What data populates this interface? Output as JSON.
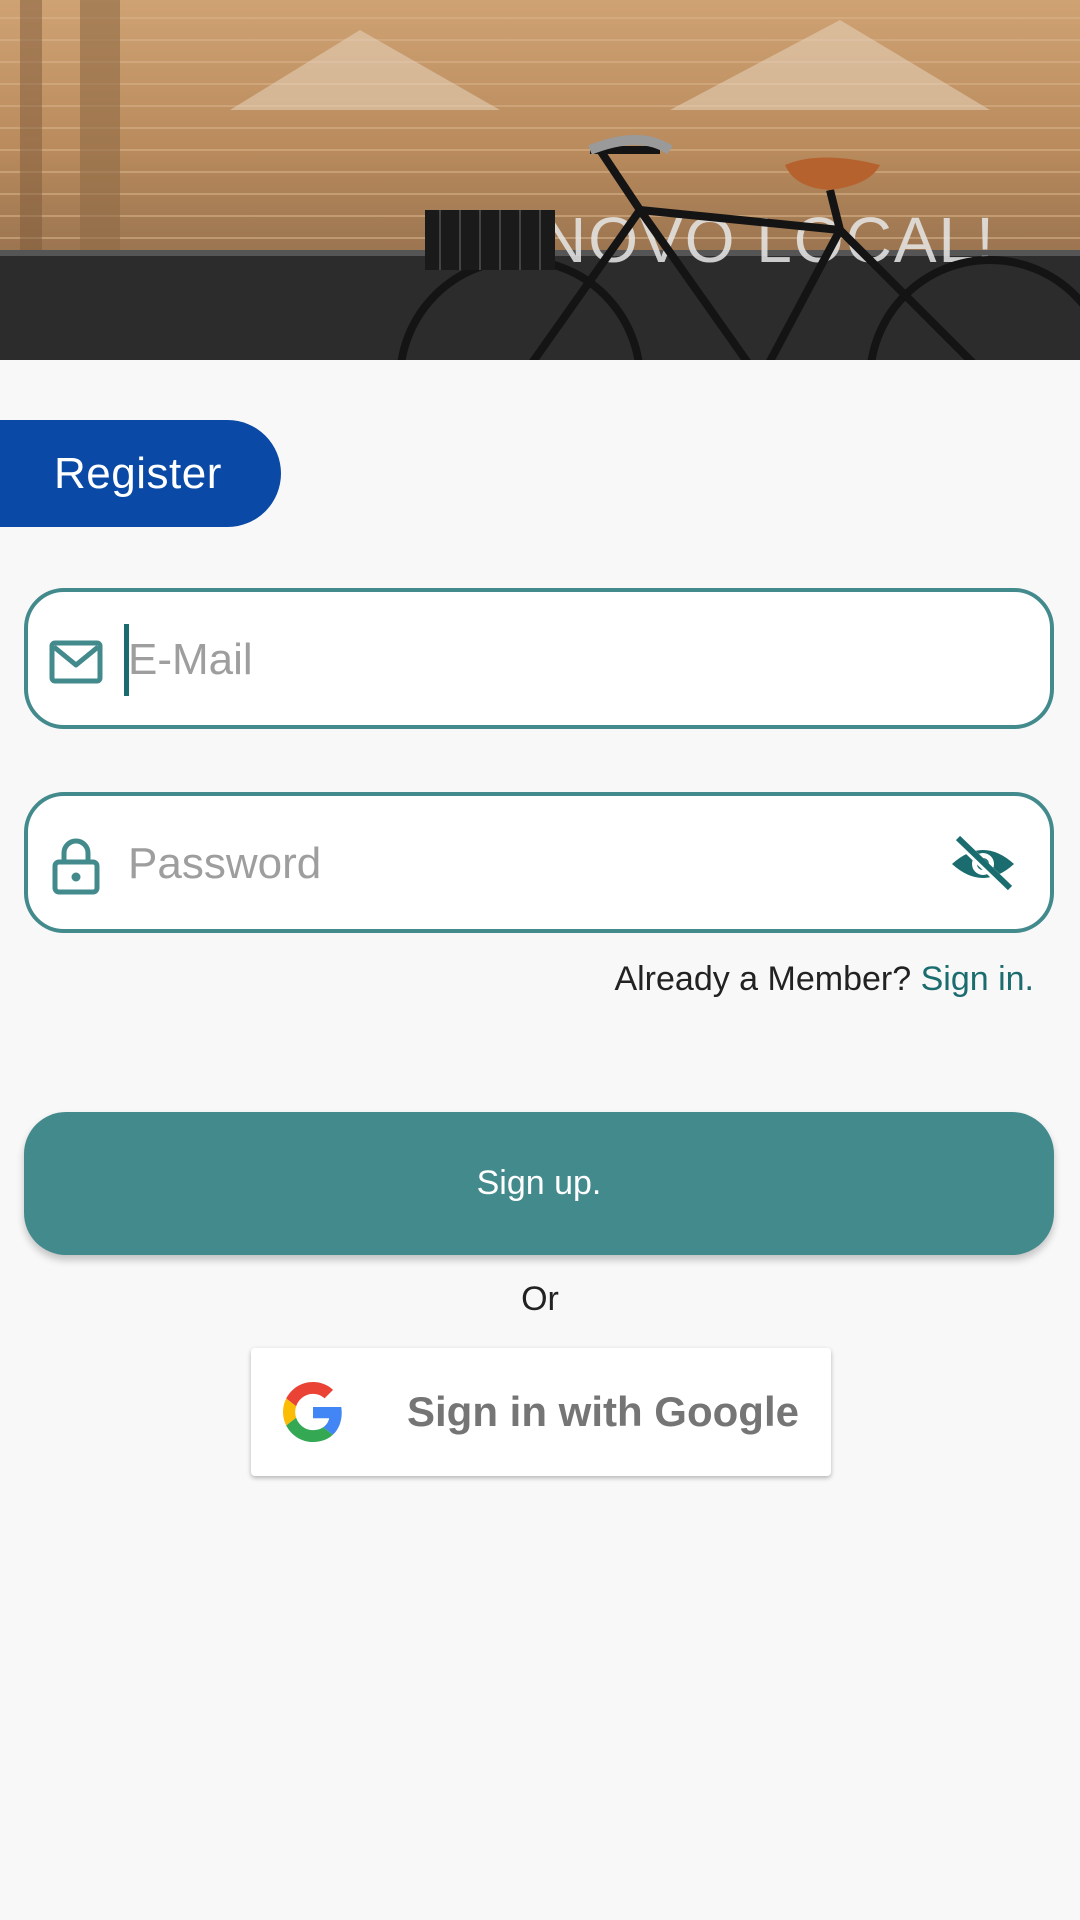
{
  "header": {
    "image_description": "bicycle-photo"
  },
  "register_tab": {
    "label": "Register"
  },
  "email_field": {
    "placeholder": "E-Mail",
    "value": ""
  },
  "password_field": {
    "placeholder": "Password",
    "value": ""
  },
  "member_prompt": {
    "text": "Already a Member?",
    "link": "Sign in."
  },
  "signup_button": {
    "label": "Sign up."
  },
  "divider": {
    "text": "Or"
  },
  "google_button": {
    "label": "Sign in with Google"
  },
  "colors": {
    "primary_teal": "#438a8d",
    "accent_blue": "#0a49a5",
    "link_teal": "#1b6c6f",
    "background": "#f8f8f8"
  },
  "icons": {
    "email": "mail-icon",
    "password": "lock-icon",
    "visibility": "eye-off-icon",
    "google": "google-logo-icon"
  }
}
